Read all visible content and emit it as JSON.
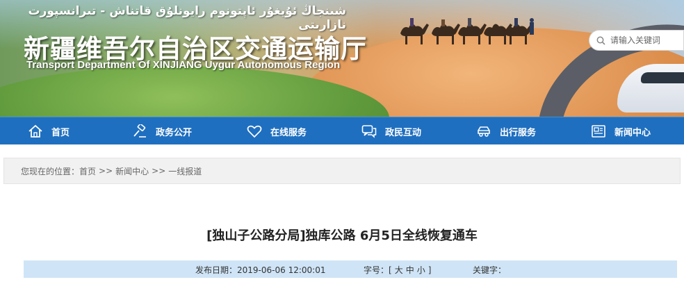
{
  "header": {
    "uyghur_title": "شىنجاڭ ئۇيغۇر ئاپتونوم رايونلۇق قاتناش - تىرانسپورت نازارىتى",
    "title": "新疆维吾尔自治区交通运输厅",
    "subtitle": "Transport Department Of XINJIANG Uygur Autonomous Region",
    "search_placeholder": "请输入关键词"
  },
  "nav": {
    "items": [
      {
        "label": "首页",
        "icon": "home-icon"
      },
      {
        "label": "政务公开",
        "icon": "gavel-icon"
      },
      {
        "label": "在线服务",
        "icon": "heart-icon"
      },
      {
        "label": "政民互动",
        "icon": "chat-icon"
      },
      {
        "label": "出行服务",
        "icon": "car-icon"
      },
      {
        "label": "新闻中心",
        "icon": "news-icon"
      }
    ]
  },
  "breadcrumb": {
    "prefix": "您现在的位置：",
    "items": [
      "首页",
      "新闻中心",
      "一线报道"
    ],
    "separator": ">>"
  },
  "article": {
    "title": "[独山子公路分局]独库公路 6月5日全线恢复通车",
    "date_label": "发布日期：",
    "date_value": "2019-06-06 12:00:01",
    "font_label": "字号：",
    "font_open": "[",
    "font_sizes": [
      "大",
      "中",
      "小"
    ],
    "font_close": "]",
    "keywords_label": "关键字："
  },
  "colors": {
    "nav_bg": "#1f6fc0",
    "meta_bg": "#cfe4f6",
    "crumb_bg": "#f1f1f1"
  }
}
